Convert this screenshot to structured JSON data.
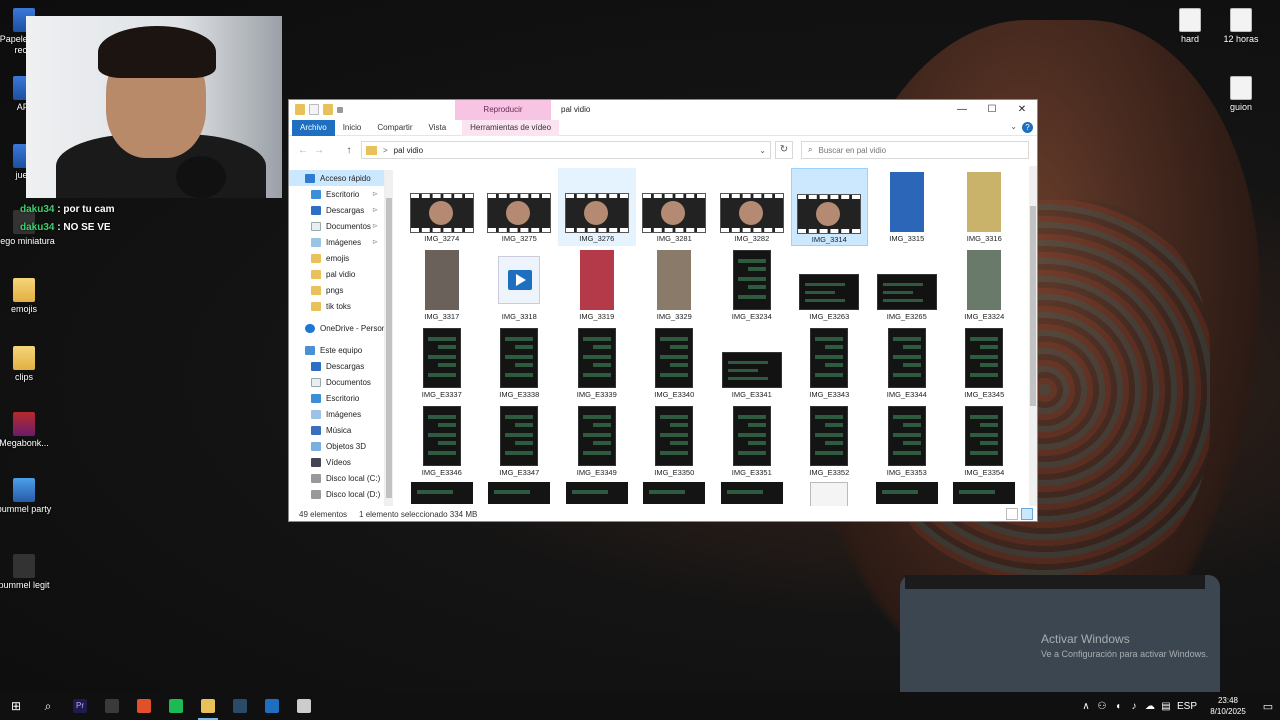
{
  "desktop": {
    "left_icons": [
      {
        "label": "Papelera de recic",
        "kind": "blue"
      },
      {
        "label": "API",
        "kind": "blue"
      },
      {
        "label": "jueg",
        "kind": "blue"
      },
      {
        "label": "juego miniatura",
        "kind": "dark"
      },
      {
        "label": "emojis",
        "kind": "folder"
      },
      {
        "label": "clips",
        "kind": "folder"
      },
      {
        "label": "Megabonk...",
        "kind": "rar"
      },
      {
        "label": "pummel party",
        "kind": "party"
      },
      {
        "label": "pummel legit",
        "kind": "dark"
      }
    ],
    "right_icons": [
      {
        "label": "hard"
      },
      {
        "label": "12 horas"
      },
      {
        "label": "guion"
      }
    ]
  },
  "chat": {
    "messages": [
      {
        "user": "daku34",
        "text": " : por tu cam"
      },
      {
        "user": "daku34",
        "text": " : NO SE VE"
      }
    ]
  },
  "explorer": {
    "context_tab": "Reproducir",
    "title": "pal vidio",
    "window_buttons": {
      "minimize": "—",
      "maximize": "☐",
      "close": "✕"
    },
    "ribbon_tabs": [
      "Archivo",
      "Inicio",
      "Compartir",
      "Vista"
    ],
    "ribbon_context_tab": "Herramientas de vídeo",
    "help": "?",
    "collapse": "⌄",
    "nav": {
      "back": "←",
      "forward": "→",
      "up": "↑"
    },
    "address": {
      "separator": ">",
      "path": "pal vidio",
      "dropdown": "⌄"
    },
    "refresh": "↻",
    "search_placeholder": "Buscar en pal vidio",
    "sidebar": {
      "quick_access": {
        "label": "Acceso rápido"
      },
      "quick_items": [
        {
          "label": "Escritorio",
          "icon": "desk",
          "pinned": true
        },
        {
          "label": "Descargas",
          "icon": "down",
          "pinned": true
        },
        {
          "label": "Documentos",
          "icon": "docs",
          "pinned": true
        },
        {
          "label": "Imágenes",
          "icon": "img",
          "pinned": true
        },
        {
          "label": "emojis",
          "icon": "fold",
          "pinned": false
        },
        {
          "label": "pal vidio",
          "icon": "fold",
          "pinned": false
        },
        {
          "label": "pngs",
          "icon": "fold",
          "pinned": false
        },
        {
          "label": "tik toks",
          "icon": "fold",
          "pinned": false
        }
      ],
      "onedrive": {
        "label": "OneDrive - Person"
      },
      "this_pc": {
        "label": "Este equipo"
      },
      "pc_items": [
        {
          "label": "Descargas",
          "icon": "down"
        },
        {
          "label": "Documentos",
          "icon": "docs"
        },
        {
          "label": "Escritorio",
          "icon": "desk"
        },
        {
          "label": "Imágenes",
          "icon": "img"
        },
        {
          "label": "Música",
          "icon": "music"
        },
        {
          "label": "Objetos 3D",
          "icon": "obj"
        },
        {
          "label": "Vídeos",
          "icon": "vid"
        },
        {
          "label": "Disco local (C:)",
          "icon": "disk"
        },
        {
          "label": "Disco local (D:)",
          "icon": "disk"
        }
      ]
    },
    "files": [
      {
        "name": "IMG_3274",
        "type": "video",
        "state": ""
      },
      {
        "name": "IMG_3275",
        "type": "video",
        "state": ""
      },
      {
        "name": "IMG_3276",
        "type": "video",
        "state": "hov"
      },
      {
        "name": "IMG_3281",
        "type": "video",
        "state": ""
      },
      {
        "name": "IMG_3282",
        "type": "video",
        "state": ""
      },
      {
        "name": "IMG_3314",
        "type": "video",
        "state": "sel"
      },
      {
        "name": "IMG_3315",
        "type": "photo",
        "state": "",
        "color": "#2b66b8"
      },
      {
        "name": "IMG_3316",
        "type": "photo",
        "state": "",
        "color": "#c9b26a"
      },
      {
        "name": "IMG_3317",
        "type": "photo",
        "state": "",
        "color": "#6a625a"
      },
      {
        "name": "IMG_3318",
        "type": "player",
        "state": ""
      },
      {
        "name": "IMG_3319",
        "type": "photo",
        "state": "",
        "color": "#b43a4a"
      },
      {
        "name": "IMG_3329",
        "type": "photo",
        "state": "",
        "color": "#8a7a6a"
      },
      {
        "name": "IMG_E3234",
        "type": "phone",
        "state": ""
      },
      {
        "name": "IMG_E3263",
        "type": "wide",
        "state": ""
      },
      {
        "name": "IMG_E3265",
        "type": "wide",
        "state": ""
      },
      {
        "name": "IMG_E3324",
        "type": "photo",
        "state": "",
        "color": "#6a7a6a"
      },
      {
        "name": "IMG_E3337",
        "type": "phone",
        "state": ""
      },
      {
        "name": "IMG_E3338",
        "type": "phone",
        "state": ""
      },
      {
        "name": "IMG_E3339",
        "type": "phone",
        "state": ""
      },
      {
        "name": "IMG_E3340",
        "type": "phone",
        "state": ""
      },
      {
        "name": "IMG_E3341",
        "type": "wide",
        "state": ""
      },
      {
        "name": "IMG_E3343",
        "type": "phone",
        "state": ""
      },
      {
        "name": "IMG_E3344",
        "type": "phone",
        "state": ""
      },
      {
        "name": "IMG_E3345",
        "type": "phone",
        "state": ""
      },
      {
        "name": "IMG_E3346",
        "type": "phone",
        "state": ""
      },
      {
        "name": "IMG_E3347",
        "type": "phone",
        "state": ""
      },
      {
        "name": "IMG_E3349",
        "type": "phone",
        "state": ""
      },
      {
        "name": "IMG_E3350",
        "type": "phone",
        "state": ""
      },
      {
        "name": "IMG_E3351",
        "type": "phone",
        "state": ""
      },
      {
        "name": "IMG_E3352",
        "type": "phone",
        "state": ""
      },
      {
        "name": "IMG_E3353",
        "type": "phone",
        "state": ""
      },
      {
        "name": "IMG_E3354",
        "type": "phone",
        "state": ""
      },
      {
        "name": "",
        "type": "strip",
        "state": ""
      },
      {
        "name": "",
        "type": "strip",
        "state": ""
      },
      {
        "name": "",
        "type": "strip",
        "state": ""
      },
      {
        "name": "",
        "type": "strip",
        "state": ""
      },
      {
        "name": "",
        "type": "strip",
        "state": ""
      },
      {
        "name": "",
        "type": "doc",
        "state": ""
      },
      {
        "name": "",
        "type": "strip",
        "state": ""
      },
      {
        "name": "",
        "type": "strip",
        "state": ""
      }
    ],
    "status": {
      "count": "49 elementos",
      "selection": "1 elemento seleccionado  334 MB"
    }
  },
  "watermark": {
    "line1": "Activar Windows",
    "line2": "Ve a Configuración para activar Windows."
  },
  "taskbar": {
    "start_glyph": "⊞",
    "search_glyph": "⌕",
    "apps": [
      {
        "name": "premiere",
        "label": "Pr",
        "color": "#1f1b4d",
        "active": false
      },
      {
        "name": "obs",
        "label": "",
        "color": "#3a3a3a",
        "active": false
      },
      {
        "name": "brave",
        "label": "",
        "color": "#e0502a",
        "active": false
      },
      {
        "name": "spotify",
        "label": "",
        "color": "#1db954",
        "active": false
      },
      {
        "name": "explorer",
        "label": "",
        "color": "#e8c15a",
        "active": true
      },
      {
        "name": "steam",
        "label": "",
        "color": "#2a4a6a",
        "active": false
      },
      {
        "name": "video-player",
        "label": "",
        "color": "#1e6fc0",
        "active": false
      },
      {
        "name": "game",
        "label": "",
        "color": "#cccccc",
        "active": false
      }
    ],
    "tray": {
      "chevron": "∧",
      "lang": "ESP",
      "time": "23:48",
      "date": "8/10/2025",
      "notification": "▭"
    }
  }
}
